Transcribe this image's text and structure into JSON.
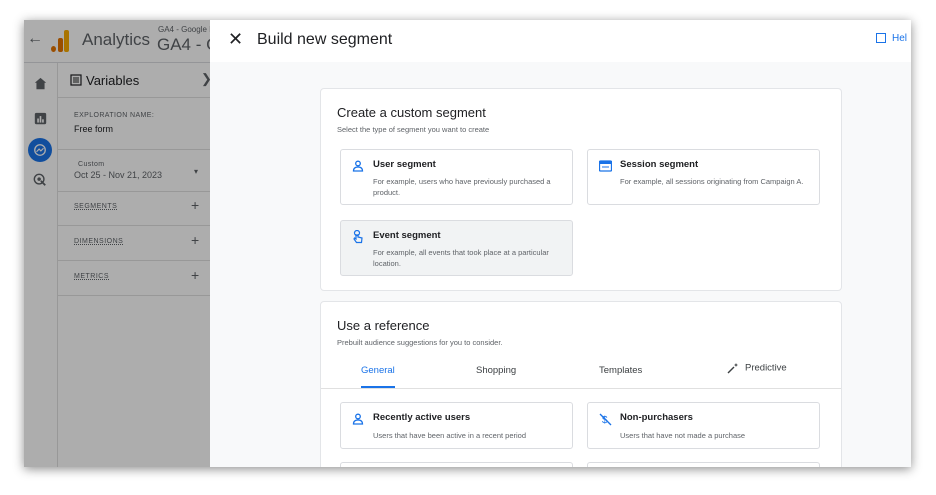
{
  "app": {
    "name": "Analytics",
    "account_small": "GA4 - Google I",
    "account_big": "GA4 - G"
  },
  "variables_panel": {
    "title": "Variables",
    "exploration_name_label": "EXPLORATION NAME:",
    "exploration_name_value": "Free form",
    "date_label": "Custom",
    "date_value": "Oct 25 - Nov 21, 2023",
    "segments_label": "SEGMENTS",
    "dimensions_label": "DIMENSIONS",
    "metrics_label": "METRICS"
  },
  "sheet": {
    "close_icon": "✕",
    "title": "Build new segment",
    "help_label": "Hel"
  },
  "custom_segment": {
    "title": "Create a custom segment",
    "subtitle": "Select the type of segment you want to create",
    "options": [
      {
        "icon": "user-icon",
        "title": "User segment",
        "description": "For example, users who have previously purchased a product."
      },
      {
        "icon": "session-icon",
        "title": "Session segment",
        "description": "For example, all sessions originating from Campaign A."
      },
      {
        "icon": "event-icon",
        "title": "Event segment",
        "description": "For example, all events that took place at a particular location."
      }
    ]
  },
  "reference": {
    "title": "Use a reference",
    "subtitle": "Prebuilt audience suggestions for you to consider.",
    "tabs": [
      "General",
      "Shopping",
      "Templates",
      "Predictive"
    ],
    "active_tab": "General",
    "suggestions": [
      {
        "icon": "user-icon",
        "title": "Recently active users",
        "description": "Users that have been active in a recent period"
      },
      {
        "icon": "no-purchase-icon",
        "title": "Non-purchasers",
        "description": "Users that have not made a purchase"
      }
    ]
  },
  "colors": {
    "accent": "#1a73e8",
    "analytics_orange": "#e37400",
    "analytics_yellow": "#f9ab00"
  }
}
